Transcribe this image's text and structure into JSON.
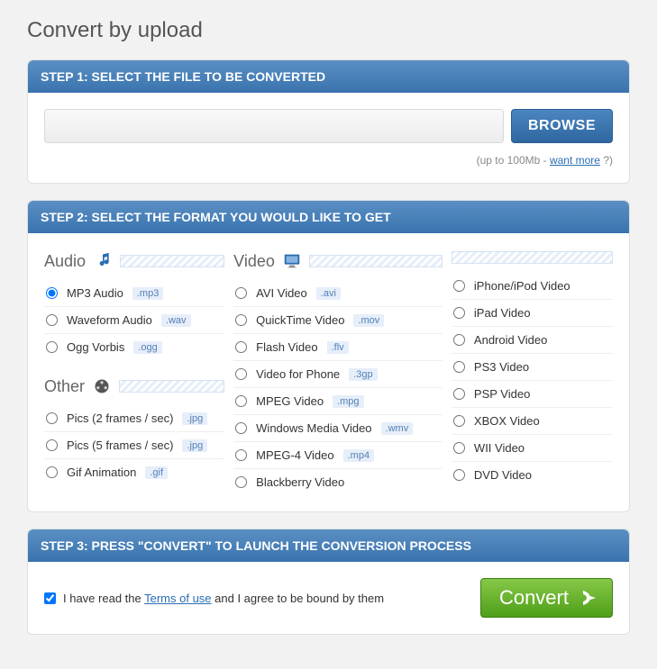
{
  "title": "Convert by upload",
  "step1": {
    "header": "STEP 1: SELECT THE FILE TO BE CONVERTED",
    "browse": "BROWSE",
    "filePlaceholder": "",
    "hintPrefix": "(up to 100Mb - ",
    "hintLink": "want more",
    "hintSuffix": " ?)"
  },
  "step2": {
    "header": "STEP 2: SELECT THE FORMAT YOU WOULD LIKE TO GET",
    "audioLabel": "Audio",
    "videoLabel": "Video",
    "otherLabel": "Other",
    "audio": [
      {
        "label": "MP3 Audio",
        "ext": ".mp3",
        "selected": true
      },
      {
        "label": "Waveform Audio",
        "ext": ".wav",
        "selected": false
      },
      {
        "label": "Ogg Vorbis",
        "ext": ".ogg",
        "selected": false
      }
    ],
    "other": [
      {
        "label": "Pics (2 frames / sec)",
        "ext": ".jpg",
        "selected": false
      },
      {
        "label": "Pics (5 frames / sec)",
        "ext": ".jpg",
        "selected": false
      },
      {
        "label": "Gif Animation",
        "ext": ".gif",
        "selected": false
      }
    ],
    "videoCol1": [
      {
        "label": "AVI Video",
        "ext": ".avi"
      },
      {
        "label": "QuickTime Video",
        "ext": ".mov"
      },
      {
        "label": "Flash Video",
        "ext": ".flv"
      },
      {
        "label": "Video for Phone",
        "ext": ".3gp"
      },
      {
        "label": "MPEG Video",
        "ext": ".mpg"
      },
      {
        "label": "Windows Media Video",
        "ext": ".wmv"
      },
      {
        "label": "MPEG-4 Video",
        "ext": ".mp4"
      },
      {
        "label": "Blackberry Video",
        "ext": ""
      }
    ],
    "videoCol2": [
      {
        "label": "iPhone/iPod Video",
        "ext": ""
      },
      {
        "label": "iPad Video",
        "ext": ""
      },
      {
        "label": "Android Video",
        "ext": ""
      },
      {
        "label": "PS3 Video",
        "ext": ""
      },
      {
        "label": "PSP Video",
        "ext": ""
      },
      {
        "label": "XBOX Video",
        "ext": ""
      },
      {
        "label": "WII Video",
        "ext": ""
      },
      {
        "label": "DVD Video",
        "ext": ""
      }
    ]
  },
  "step3": {
    "header": "STEP 3: PRESS \"CONVERT\" TO LAUNCH THE CONVERSION PROCESS",
    "termsPrefix": "I have read the ",
    "termsLink": "Terms of use",
    "termsSuffix": " and I agree to be bound by them",
    "termsChecked": true,
    "convert": "Convert"
  }
}
